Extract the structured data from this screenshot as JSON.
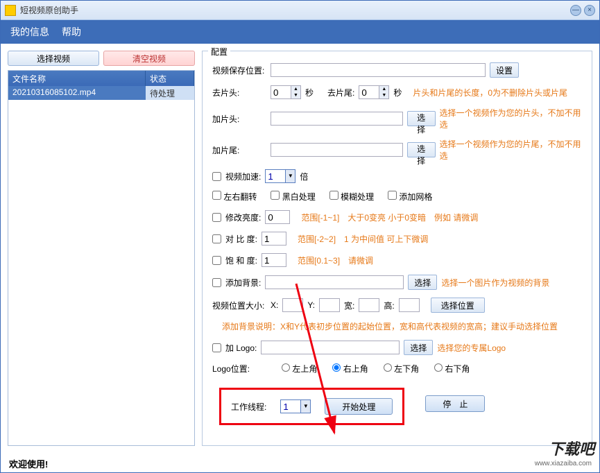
{
  "app_title": "短视频原创助手",
  "menu": {
    "info": "我的信息",
    "help": "帮助"
  },
  "left": {
    "select_video": "选择视频",
    "clear_video": "清空视频",
    "col_name": "文件名称",
    "col_status": "状态",
    "file_name": "20210316085102.mp4",
    "file_status": "待处理"
  },
  "config": {
    "title": "配置",
    "save_path_label": "视频保存位置:",
    "save_path": "",
    "set_btn": "设置",
    "trim_head_label": "去片头:",
    "trim_head": "0",
    "trim_tail_label": "去片尾:",
    "trim_tail": "0",
    "seconds": "秒",
    "trim_hint": "片头和片尾的长度，0为不删除片头或片尾",
    "add_head_label": "加片头:",
    "add_head": "",
    "select_btn": "选择",
    "add_head_hint": "选择一个视频作为您的片头，不加不用选",
    "add_tail_label": "加片尾:",
    "add_tail": "",
    "add_tail_hint": "选择一个视频作为您的片尾，不加不用选",
    "speed_label": "视频加速:",
    "speed": "1",
    "speed_unit": "倍",
    "flip_label": "左右翻转",
    "bw_label": "黑白处理",
    "blur_label": "模糊处理",
    "grid_label": "添加网格",
    "brightness_label": "修改亮度:",
    "brightness": "0",
    "brightness_hint": "范围[-1~1]　大于0变亮 小于0变暗　例如 请微调",
    "contrast_label": "对 比  度:",
    "contrast": "1",
    "contrast_hint": "范围[-2~2]　1 为中间值  可上下微调",
    "saturation_label": "饱 和  度:",
    "saturation": "1",
    "saturation_hint": "范围[0.1~3]　请微调",
    "bg_label": "添加背景:",
    "bg": "",
    "bg_hint": "选择一个图片作为视频的背景",
    "pos_label": "视频位置大小:",
    "x_label": "X:",
    "x": "",
    "y_label": "Y:",
    "y": "",
    "w_label": "宽:",
    "w": "",
    "h_label": "高:",
    "h": "",
    "pos_btn": "选择位置",
    "pos_hint": "添加背景说明：X和Y代表初步位置的起始位置，宽和高代表视频的宽高；建议手动选择位置",
    "logo_label": "加 Logo:",
    "logo": "",
    "logo_hint": "选择您的专属Logo",
    "logo_pos_label": "Logo位置:",
    "pos_tl": "左上角",
    "pos_tr": "右上角",
    "pos_bl": "左下角",
    "pos_br": "右下角",
    "threads_label": "工作线程:",
    "threads": "1",
    "start_btn": "开始处理",
    "stop_btn": "停　止"
  },
  "footer": "欢迎使用!",
  "watermark": "下载吧",
  "watermark_url": "www.xiazaiba.com"
}
